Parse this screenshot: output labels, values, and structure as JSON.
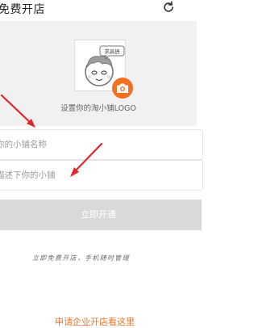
{
  "header": {
    "title": "免费开店",
    "refresh_icon": "refresh-icon"
  },
  "logo": {
    "badge_text": "求高债",
    "caption": "设置你的淘小铺LOGO",
    "camera_icon": "camera-icon"
  },
  "form": {
    "name_placeholder": "你的小铺名称",
    "desc_placeholder": "描述下你的小铺"
  },
  "submit_label": "立即开通",
  "slogan": "立即免费开店，手机随时管理",
  "enterprise_link": "申请企业开店看这里",
  "colors": {
    "accent": "#f37021",
    "annotation": "#e0262e",
    "button_disabled": "#d9d9d9"
  }
}
